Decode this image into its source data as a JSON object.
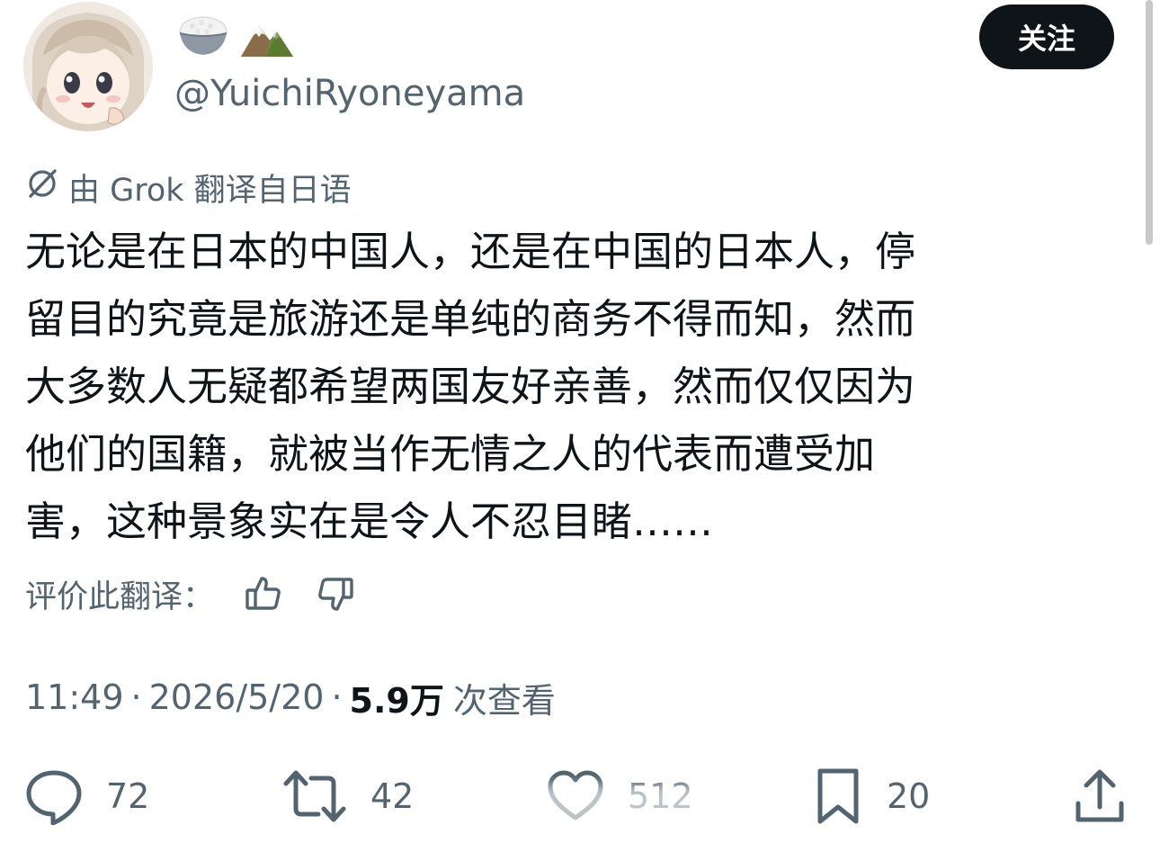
{
  "author": {
    "display_name_emojis": [
      "rice-bowl-icon",
      "snow-capped-mountain-icon"
    ],
    "handle": "@YuichiRyoneyama"
  },
  "header": {
    "follow_label": "关注"
  },
  "translation": {
    "label": "由 Grok 翻译自日语",
    "rate_label": "评价此翻译："
  },
  "tweet": {
    "lines": [
      "无论是在日本的中国人，还是在中国的日本人，停",
      "留目的究竟是旅游还是单纯的商务不得而知，然而",
      "大多数人无疑都希望两国友好亲善，然而仅仅因为",
      "他们的国籍，就被当作无情之人的代表而遭受加",
      "害，这种景象实在是令人不忍目睹……"
    ]
  },
  "meta": {
    "time": "11:49",
    "date": "2026/5/20",
    "views_count": "5.9万",
    "views_label": "次查看",
    "separator": "·"
  },
  "actions": {
    "reply_count": "72",
    "retweet_count": "42",
    "like_count": "512",
    "bookmark_count": "20"
  },
  "colors": {
    "text_primary": "#0f1419",
    "text_secondary": "#536471",
    "follow_button_bg": "#0f1419",
    "follow_button_text": "#ffffff"
  }
}
